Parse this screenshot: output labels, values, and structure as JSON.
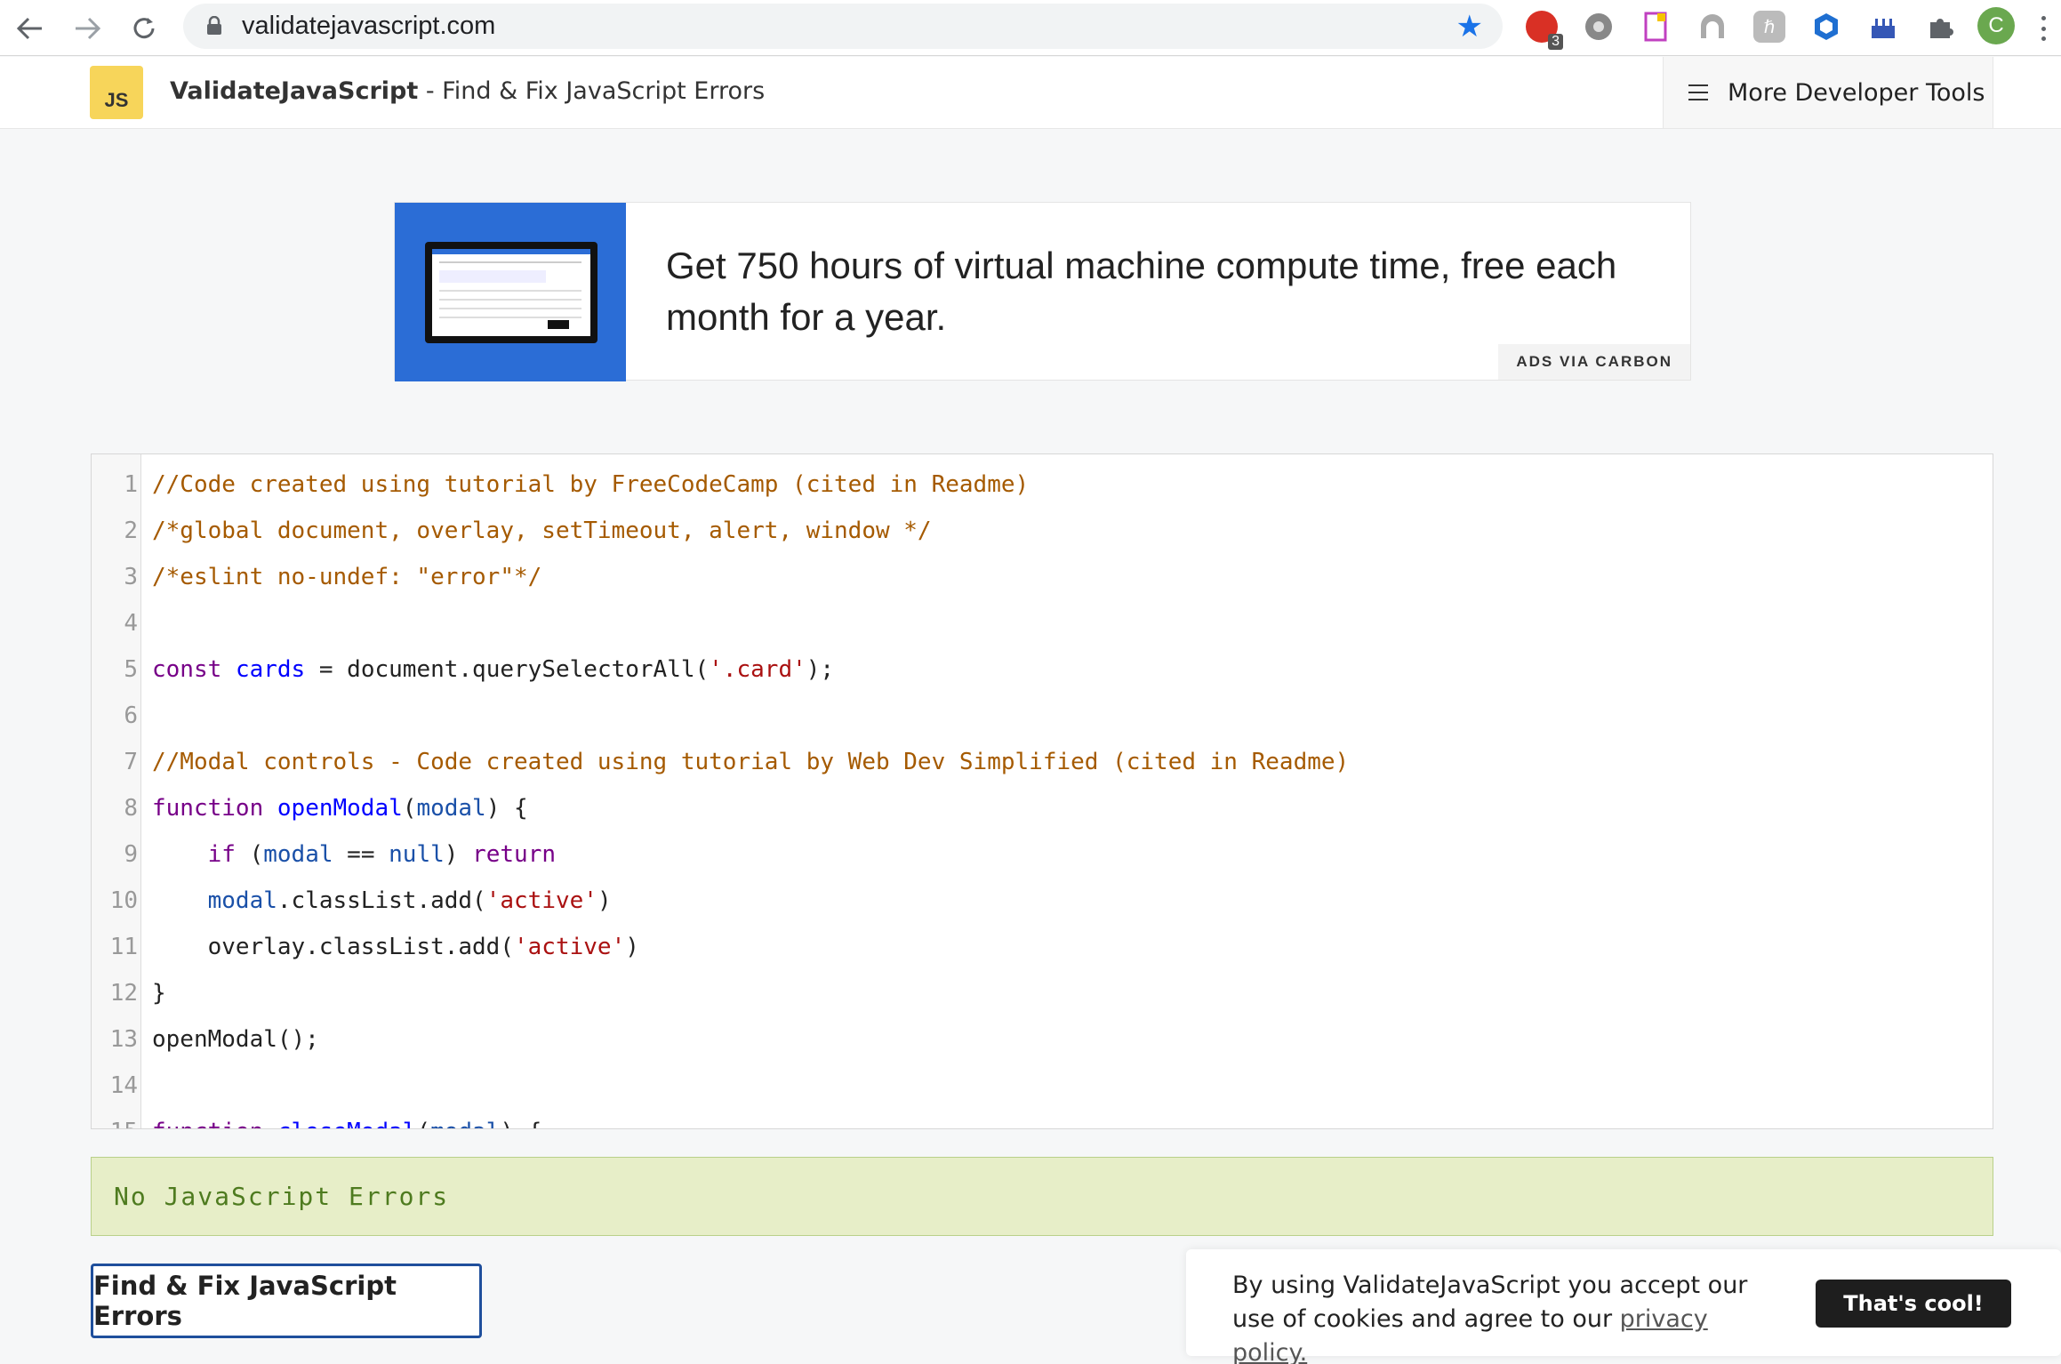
{
  "browser": {
    "url": "validatejavascript.com",
    "extension_badge": "3",
    "profile_initial": "C",
    "icons": [
      "back-arrow-icon",
      "forward-arrow-icon",
      "reload-icon",
      "lock-icon",
      "bookmark-star-icon",
      "extension-icons",
      "puzzle-icon",
      "profile-avatar"
    ]
  },
  "header": {
    "logo_text": "JS",
    "brand_name": "ValidateJavaScript",
    "brand_tagline": " - Find & Fix JavaScript Errors",
    "more_tools_label": "More Developer Tools"
  },
  "ad": {
    "text": "Get 750 hours of virtual machine compute time, free each month for a year.",
    "via_label": "ADS VIA CARBON",
    "accent_color": "#2b6dd6"
  },
  "editor": {
    "lines": [
      {
        "n": "1",
        "tokens": [
          {
            "t": "//Code created using tutorial by FreeCodeCamp (cited in Readme)",
            "c": "c-com"
          }
        ]
      },
      {
        "n": "2",
        "tokens": [
          {
            "t": "/*global document, overlay, setTimeout, alert, window */",
            "c": "c-com"
          }
        ]
      },
      {
        "n": "3",
        "tokens": [
          {
            "t": "/*eslint no-undef: \"error\"*/",
            "c": "c-com"
          }
        ]
      },
      {
        "n": "4",
        "tokens": []
      },
      {
        "n": "5",
        "tokens": [
          {
            "t": "const",
            "c": "c-kw"
          },
          {
            "t": " ",
            "c": "c-pl"
          },
          {
            "t": "cards",
            "c": "c-def"
          },
          {
            "t": " = document.querySelectorAll(",
            "c": "c-pl"
          },
          {
            "t": "'.card'",
            "c": "c-str"
          },
          {
            "t": ");",
            "c": "c-pl"
          }
        ]
      },
      {
        "n": "6",
        "tokens": []
      },
      {
        "n": "7",
        "tokens": [
          {
            "t": "//Modal controls - Code created using tutorial by Web Dev Simplified (cited in Readme)",
            "c": "c-com"
          }
        ]
      },
      {
        "n": "8",
        "tokens": [
          {
            "t": "function",
            "c": "c-kw"
          },
          {
            "t": " ",
            "c": "c-pl"
          },
          {
            "t": "openModal",
            "c": "c-def"
          },
          {
            "t": "(",
            "c": "c-pl"
          },
          {
            "t": "modal",
            "c": "c-var"
          },
          {
            "t": ") {",
            "c": "c-pl"
          }
        ]
      },
      {
        "n": "9",
        "tokens": [
          {
            "t": "    ",
            "c": "c-pl"
          },
          {
            "t": "if",
            "c": "c-kw"
          },
          {
            "t": " (",
            "c": "c-pl"
          },
          {
            "t": "modal",
            "c": "c-var"
          },
          {
            "t": " == ",
            "c": "c-pl"
          },
          {
            "t": "null",
            "c": "c-var"
          },
          {
            "t": ") ",
            "c": "c-pl"
          },
          {
            "t": "return",
            "c": "c-kw"
          }
        ]
      },
      {
        "n": "10",
        "tokens": [
          {
            "t": "    ",
            "c": "c-pl"
          },
          {
            "t": "modal",
            "c": "c-var"
          },
          {
            "t": ".classList.add(",
            "c": "c-pl"
          },
          {
            "t": "'active'",
            "c": "c-str"
          },
          {
            "t": ")",
            "c": "c-pl"
          }
        ]
      },
      {
        "n": "11",
        "tokens": [
          {
            "t": "    overlay.classList.add(",
            "c": "c-pl"
          },
          {
            "t": "'active'",
            "c": "c-str"
          },
          {
            "t": ")",
            "c": "c-pl"
          }
        ]
      },
      {
        "n": "12",
        "tokens": [
          {
            "t": "}",
            "c": "c-pl"
          }
        ]
      },
      {
        "n": "13",
        "tokens": [
          {
            "t": "openModal();",
            "c": "c-pl"
          }
        ]
      },
      {
        "n": "14",
        "tokens": []
      },
      {
        "n": "15",
        "tokens": [
          {
            "t": "function",
            "c": "c-kw"
          },
          {
            "t": " ",
            "c": "c-pl"
          },
          {
            "t": "closeModal",
            "c": "c-def"
          },
          {
            "t": "(",
            "c": "c-pl"
          },
          {
            "t": "modal",
            "c": "c-var"
          },
          {
            "t": ") {",
            "c": "c-pl"
          }
        ]
      }
    ]
  },
  "result": {
    "message": "No JavaScript Errors"
  },
  "actions": {
    "main_button_label": "Find & Fix JavaScript Errors"
  },
  "cookie": {
    "text": "By using ValidateJavaScript you accept our use of cookies and agree to our ",
    "link_label": "privacy policy.",
    "button_label": "That's cool!"
  }
}
